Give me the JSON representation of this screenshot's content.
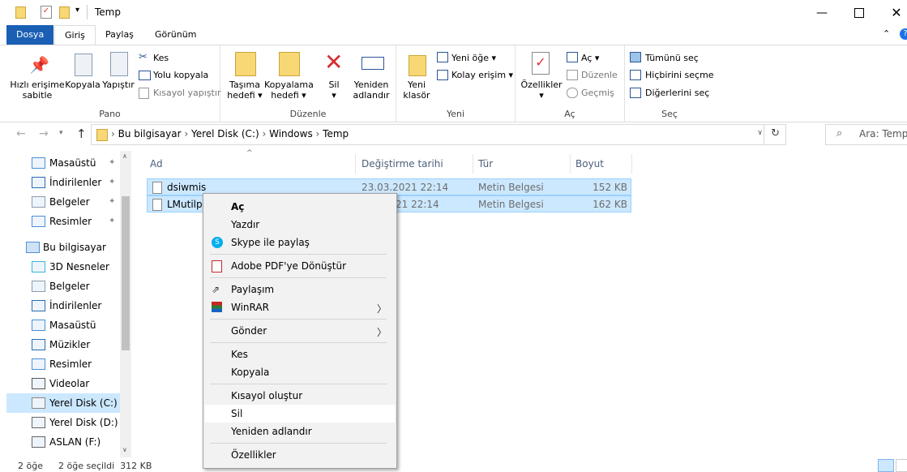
{
  "window": {
    "title": "Temp"
  },
  "tabs": {
    "file": "Dosya",
    "home": "Giriş",
    "share": "Paylaş",
    "view": "Görünüm"
  },
  "ribbon": {
    "pano": {
      "label": "Pano",
      "pin": "Hızlı erişime sabitle",
      "copy": "Kopyala",
      "paste": "Yapıştır",
      "cut": "Kes",
      "copy_path": "Yolu kopyala",
      "paste_shortcut": "Kısayol yapıştır"
    },
    "duzenle": {
      "label": "Düzenle",
      "move": "Taşıma hedefi",
      "copy_to": "Kopyalama hedefi",
      "delete": "Sil",
      "rename": "Yeniden adlandır"
    },
    "yeni": {
      "label": "Yeni",
      "new_folder": "Yeni klasör",
      "new_item": "Yeni öğe",
      "easy_access": "Kolay erişim"
    },
    "ac": {
      "label": "Aç",
      "properties": "Özellikler",
      "open": "Aç",
      "edit": "Düzenle",
      "history": "Geçmiş"
    },
    "sec": {
      "label": "Seç",
      "select_all": "Tümünü seç",
      "select_none": "Hiçbirini seçme",
      "invert": "Diğerlerini seç"
    }
  },
  "address": {
    "crumbs": [
      "Bu bilgisayar",
      "Yerel Disk (C:)",
      "Windows",
      "Temp"
    ],
    "search_placeholder": "Ara: Temp"
  },
  "sidebar": {
    "items": [
      {
        "label": "Masaüstü",
        "pinned": true
      },
      {
        "label": "İndirilenler",
        "pinned": true
      },
      {
        "label": "Belgeler",
        "pinned": true
      },
      {
        "label": "Resimler",
        "pinned": true
      },
      {
        "label": "Bu bilgisayar"
      },
      {
        "label": "3D Nesneler"
      },
      {
        "label": "Belgeler"
      },
      {
        "label": "İndirilenler"
      },
      {
        "label": "Masaüstü"
      },
      {
        "label": "Müzikler"
      },
      {
        "label": "Resimler"
      },
      {
        "label": "Videolar"
      },
      {
        "label": "Yerel Disk (C:)",
        "selected": true
      },
      {
        "label": "Yerel Disk (D:)"
      },
      {
        "label": "ASLAN (F:)"
      }
    ]
  },
  "columns": {
    "name": "Ad",
    "date": "Değiştirme tarihi",
    "type": "Tür",
    "size": "Boyut"
  },
  "files": [
    {
      "name": "dsiwmis",
      "date": "23.03.2021 22:14",
      "type": "Metin Belgesi",
      "size": "152 KB"
    },
    {
      "name": "LMutilps",
      "date": "21 22:14",
      "type": "Metin Belgesi",
      "size": "162 KB"
    }
  ],
  "context_menu": {
    "open": "Aç",
    "print": "Yazdır",
    "skype": "Skype ile paylaş",
    "adobe": "Adobe PDF'ye Dönüştür",
    "share": "Paylaşım",
    "winrar": "WinRAR",
    "send_to": "Gönder",
    "cut": "Kes",
    "copy": "Kopyala",
    "create_shortcut": "Kısayol oluştur",
    "delete": "Sil",
    "rename": "Yeniden adlandır",
    "properties": "Özellikler"
  },
  "status": {
    "count": "2 öğe",
    "selected": "2 öğe seçildi  312 KB"
  },
  "colors": {
    "accent": "#1a5fb4",
    "selection": "#cce8ff",
    "folder": "#f8d775"
  }
}
